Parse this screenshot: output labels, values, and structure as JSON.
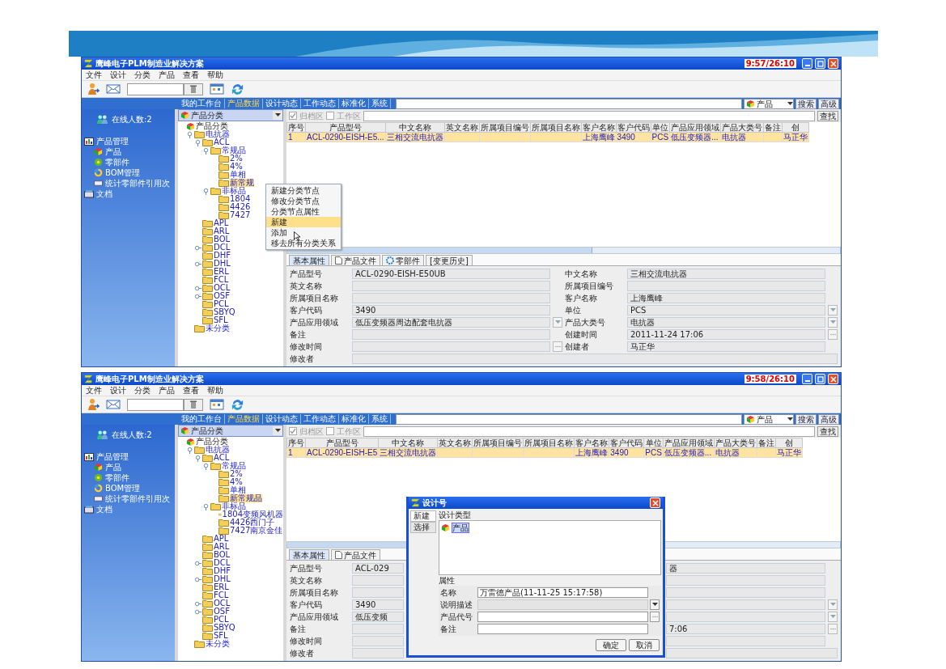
{
  "windows": [
    {
      "title": "鹰峰电子PLM制造业解决方案",
      "clock": "9:57/26:10",
      "menu": [
        "文件",
        "设计",
        "分类",
        "产品",
        "查看",
        "帮助"
      ],
      "nav": {
        "links": [
          {
            "label": "我的工作台",
            "selected": false
          },
          {
            "label": "产品数据",
            "selected": true
          },
          {
            "label": "设计动态",
            "selected": false
          },
          {
            "label": "工作动态",
            "selected": false
          },
          {
            "label": "标准化",
            "selected": false
          },
          {
            "label": "系统",
            "selected": false
          }
        ],
        "scope": "产品",
        "buttons": [
          "搜索",
          "高级"
        ]
      },
      "online": "在线人数:2",
      "sidebar": [
        {
          "label": "产品管理",
          "children": [
            "产品",
            "零部件",
            "BOM管理",
            "统计零部件引用次"
          ]
        },
        {
          "label": "文档"
        }
      ],
      "tree_header": "产品分类",
      "tree": [
        {
          "label": "产品分类",
          "selected": false,
          "children": [
            {
              "label": "电抗器",
              "selected": false,
              "expanded": true,
              "children": [
                {
                  "label": "ACL",
                  "selected": false,
                  "expanded": true,
                  "children": [
                    {
                      "label": "常规品",
                      "selected": false,
                      "expanded": true,
                      "children": [
                        {
                          "label": "2%",
                          "selected": false
                        },
                        {
                          "label": "4%",
                          "selected": false
                        },
                        {
                          "label": "单相",
                          "selected": false
                        },
                        {
                          "label": "新常规",
                          "selected": true
                        }
                      ]
                    },
                    {
                      "label": "非标品",
                      "selected": false,
                      "expanded": true,
                      "children": [
                        {
                          "label": "1804",
                          "selected": false
                        },
                        {
                          "label": "4426",
                          "selected": false
                        },
                        {
                          "label": "7427",
                          "selected": false
                        }
                      ]
                    }
                  ]
                },
                {
                  "label": "APL",
                  "selected": false
                },
                {
                  "label": "ARL",
                  "selected": false
                },
                {
                  "label": "BOL",
                  "selected": false
                },
                {
                  "label": "DCL",
                  "selected": false,
                  "expanded": false
                },
                {
                  "label": "DHF",
                  "selected": false
                },
                {
                  "label": "DHL",
                  "selected": false,
                  "expanded": false
                },
                {
                  "label": "ERL",
                  "selected": false
                },
                {
                  "label": "FCL",
                  "selected": false
                },
                {
                  "label": "OCL",
                  "selected": false,
                  "expanded": false
                },
                {
                  "label": "OSF",
                  "selected": false,
                  "expanded": false
                },
                {
                  "label": "PCL",
                  "selected": false
                },
                {
                  "label": "SBYQ",
                  "selected": false
                },
                {
                  "label": "SFL",
                  "selected": false
                }
              ]
            },
            {
              "label": "未分类",
              "selected": false
            }
          ]
        }
      ],
      "context_menu": [
        {
          "label": "新建分类节点",
          "selected": false
        },
        {
          "label": "修改分类节点",
          "selected": false
        },
        {
          "label": "分类节点属性",
          "selected": false
        },
        {
          "label": "新建",
          "selected": true
        },
        {
          "label": "添加",
          "selected": false
        },
        {
          "label": "移去所有分类关系",
          "selected": false
        }
      ],
      "filters": [
        {
          "label": "归档区",
          "checked": true,
          "disabled": true
        },
        {
          "label": "工作区",
          "checked": false,
          "disabled": true
        }
      ],
      "find_button": "查找",
      "table": {
        "columns": [
          "序号",
          "产品型号",
          "中文名称",
          "英文名称",
          "所属项目编号",
          "所属项目名称",
          "客户名称",
          "客户代码",
          "单位",
          "产品应用领域",
          "产品大类号",
          "备注",
          "创"
        ],
        "rows": [
          {
            "selected": true,
            "cells": [
              "1",
              "ACL-0290-EISH-E5...",
              "三相交流电抗器",
              null,
              null,
              null,
              "上海鹰峰",
              "3490",
              "PCS",
              "低压变频器...",
              "电抗器",
              null,
              "马正华"
            ]
          }
        ]
      },
      "tabs": [
        {
          "label": "基本属性",
          "selected": true
        },
        {
          "label": "产品文件",
          "selected": false
        },
        {
          "label": "零部件",
          "selected": false
        },
        {
          "label": "[变更历史]",
          "selected": false
        }
      ],
      "properties": [
        {
          "left": {
            "label": "产品型号",
            "value": "ACL-0290-EISH-E50UB",
            "kind": "text"
          },
          "right": {
            "label": "中文名称",
            "value": "三相交流电抗器",
            "kind": "text"
          }
        },
        {
          "left": {
            "label": "英文名称",
            "kind": "text"
          },
          "right": {
            "label": "所属项目编号",
            "kind": "text"
          }
        },
        {
          "left": {
            "label": "所属项目名称",
            "kind": "text"
          },
          "right": {
            "label": "客户名称",
            "value": "上海鹰峰",
            "kind": "text"
          }
        },
        {
          "left": {
            "label": "客户代码",
            "value": "3490",
            "kind": "text"
          },
          "right": {
            "label": "单位",
            "value": "PCS",
            "kind": "dropdown"
          }
        },
        {
          "left": {
            "label": "产品应用领域",
            "value": "低压变频器周边配套电抗器",
            "kind": "dropdown"
          },
          "right": {
            "label": "产品大类号",
            "value": "电抗器",
            "kind": "dropdown"
          }
        },
        {
          "left": {
            "label": "备注",
            "kind": "text"
          },
          "right": {
            "label": "创建时间",
            "value": "2011-11-24 17:06",
            "kind": "picker"
          }
        },
        {
          "left": {
            "label": "修改时间",
            "kind": "picker"
          },
          "right": {
            "label": "创建者",
            "value": "马正华",
            "kind": "text"
          }
        },
        {
          "left": {
            "label": "修改者"
          }
        }
      ]
    },
    {
      "title": "鹰峰电子PLM制造业解决方案",
      "clock": "9:58/26:10",
      "menu": [
        "文件",
        "设计",
        "分类",
        "产品",
        "查看",
        "帮助"
      ],
      "nav": {
        "links": [
          {
            "label": "我的工作台",
            "selected": false
          },
          {
            "label": "产品数据",
            "selected": true
          },
          {
            "label": "设计动态",
            "selected": false
          },
          {
            "label": "工作动态",
            "selected": false
          },
          {
            "label": "标准化",
            "selected": false
          },
          {
            "label": "系统",
            "selected": false
          }
        ],
        "scope": "产品",
        "buttons": [
          "搜索",
          "高级"
        ]
      },
      "online": "在线人数:2",
      "sidebar": [
        {
          "label": "产品管理",
          "children": [
            "产品",
            "零部件",
            "BOM管理",
            "统计零部件引用次"
          ]
        },
        {
          "label": "文档"
        }
      ],
      "tree_header": "产品分类",
      "tree": [
        {
          "label": "产品分类",
          "selected": false,
          "children": [
            {
              "label": "电抗器",
              "selected": false,
              "expanded": true,
              "children": [
                {
                  "label": "ACL",
                  "selected": false,
                  "expanded": true,
                  "children": [
                    {
                      "label": "常规品",
                      "selected": false,
                      "expanded": true,
                      "children": [
                        {
                          "label": "2%",
                          "selected": false
                        },
                        {
                          "label": "4%",
                          "selected": false
                        },
                        {
                          "label": "单相",
                          "selected": false
                        },
                        {
                          "label": "新常规品",
                          "selected": true
                        }
                      ]
                    },
                    {
                      "label": "非标品",
                      "selected": false,
                      "expanded": true,
                      "children": [
                        {
                          "label": "1804变频风机器",
                          "selected": false
                        },
                        {
                          "label": "4426西门子",
                          "selected": false
                        },
                        {
                          "label": "7427南京金佳",
                          "selected": false
                        }
                      ]
                    }
                  ]
                },
                {
                  "label": "APL",
                  "selected": false
                },
                {
                  "label": "ARL",
                  "selected": false
                },
                {
                  "label": "BOL",
                  "selected": false
                },
                {
                  "label": "DCL",
                  "selected": false,
                  "expanded": false
                },
                {
                  "label": "DHF",
                  "selected": false
                },
                {
                  "label": "DHL",
                  "selected": false,
                  "expanded": false
                },
                {
                  "label": "ERL",
                  "selected": false
                },
                {
                  "label": "FCL",
                  "selected": false
                },
                {
                  "label": "OCL",
                  "selected": false,
                  "expanded": false
                },
                {
                  "label": "OSF",
                  "selected": false,
                  "expanded": false
                },
                {
                  "label": "PCL",
                  "selected": false
                },
                {
                  "label": "SBYQ",
                  "selected": false
                },
                {
                  "label": "SFL",
                  "selected": false
                }
              ]
            },
            {
              "label": "未分类",
              "selected": false
            }
          ]
        }
      ],
      "filters": [
        {
          "label": "归档区",
          "checked": true,
          "disabled": true
        },
        {
          "label": "工作区",
          "checked": false,
          "disabled": true
        }
      ],
      "find_button": "查找",
      "table": {
        "columns": [
          "序号",
          "产品型号",
          "中文名称",
          "英文名称",
          "所属项目编号",
          "所属项目名称",
          "客户名称",
          "客户代码",
          "单位",
          "产品应用领域",
          "产品大类号",
          "备注",
          "创"
        ],
        "rows": [
          {
            "selected": true,
            "cells": [
              "1",
              "ACL-0290-EISH-E5",
              "三相交流电抗器",
              null,
              null,
              null,
              "上海鹰峰",
              "3490",
              "PCS",
              "低压变频器...",
              "电抗器",
              null,
              "马正华"
            ]
          }
        ]
      },
      "tabs": [
        {
          "label": "基本属性",
          "selected": true
        },
        {
          "label": "产品文件",
          "selected": false
        }
      ],
      "properties": [
        {
          "left": {
            "label": "产品型号",
            "value": "ACL-029"
          },
          "right": {
            "value": "器",
            "kind": "text"
          }
        },
        {
          "left": {
            "label": "英文名称"
          },
          "right": {
            "kind": "text"
          }
        },
        {
          "left": {
            "label": "所属项目名称"
          },
          "right": {
            "kind": "text"
          }
        },
        {
          "left": {
            "label": "客户代码",
            "value": "3490"
          },
          "right": {
            "kind": "dropdown"
          }
        },
        {
          "left": {
            "label": "产品应用领域",
            "value": "低压变频"
          },
          "right": {
            "kind": "dropdown"
          }
        },
        {
          "left": {
            "label": "备注"
          },
          "right": {
            "value": "7:06",
            "kind": "picker"
          }
        },
        {
          "left": {
            "label": "修改时间"
          },
          "right": {
            "kind": "text"
          }
        },
        {
          "left": {
            "label": "修改者"
          }
        }
      ],
      "dialog": {
        "title": "设计号",
        "tabs": [
          {
            "label": "新建",
            "selected": true
          },
          {
            "label": "选择",
            "selected": false
          }
        ],
        "type_group": {
          "label": "设计类型",
          "items": [
            {
              "label": "产品",
              "selected": true
            }
          ]
        },
        "attr_group": {
          "label": "属性",
          "fields": [
            {
              "label": "名称",
              "value": "万雷德产品(11-11-25 15:17:58)",
              "kind": "text",
              "disabled": false
            },
            {
              "label": "说明描述",
              "kind": "dropdown",
              "disabled": true
            },
            {
              "label": "产品代号",
              "kind": "picker",
              "disabled": false
            },
            {
              "label": "备注",
              "kind": "text",
              "disabled": false
            }
          ]
        },
        "buttons": [
          "确定",
          "取消"
        ]
      }
    }
  ]
}
